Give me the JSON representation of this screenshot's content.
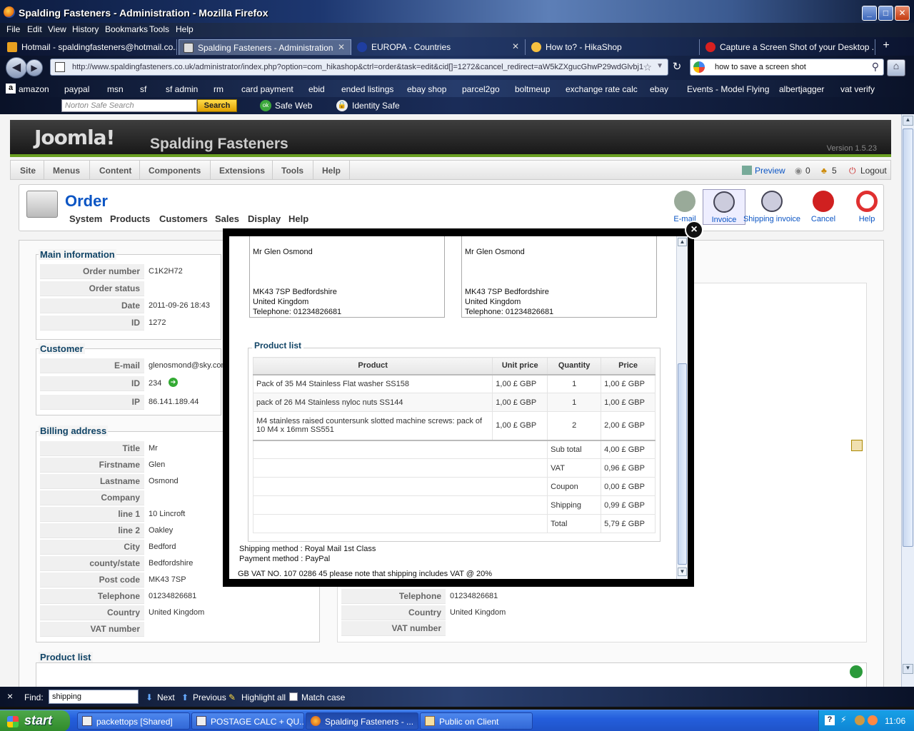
{
  "window": {
    "title": "Spalding Fasteners - Administration - Mozilla Firefox"
  },
  "menubar": [
    "File",
    "Edit",
    "View",
    "History",
    "Bookmarks",
    "Tools",
    "Help"
  ],
  "tabs": [
    {
      "label": "Hotmail - spaldingfasteners@hotmail.co...",
      "active": false
    },
    {
      "label": "Spalding Fasteners - Administration",
      "active": true
    },
    {
      "label": "EUROPA - Countries",
      "active": false
    },
    {
      "label": "How to? - HikaShop",
      "active": false
    },
    {
      "label": "Capture a Screen Shot of your Desktop ...",
      "active": false
    }
  ],
  "address": {
    "url": "http://www.spaldingfasteners.co.uk/administrator/index.php?option=com_hikashop&ctrl=order&task=edit&cid[]=1272&cancel_redirect=aW5kZXgucGhwP29wdGlvbj1"
  },
  "search": {
    "value": "how to save a screen shot"
  },
  "bookmarks": [
    "amazon",
    "paypal",
    "msn",
    "sf",
    "sf admin",
    "rm",
    "card payment",
    "ebid",
    "ended listings",
    "ebay shop",
    "parcel2go",
    "boltmeup",
    "exchange rate calc",
    "ebay",
    "Events - Model Flying",
    "albertjagger",
    "vat verify"
  ],
  "norton": {
    "placeholder": "Norton Safe Search",
    "search_label": "Search",
    "safeweb": "Safe Web",
    "identity": "Identity Safe"
  },
  "joomla": {
    "logo": "Joomla!",
    "site": "Spalding Fasteners",
    "version": "Version 1.5.23",
    "menu": [
      "Site",
      "Menus",
      "Content",
      "Components",
      "Extensions",
      "Tools",
      "Help"
    ],
    "right": {
      "preview": "Preview",
      "count1": "0",
      "count2": "5",
      "logout": "Logout"
    }
  },
  "order_header": {
    "title": "Order",
    "subnav": [
      "System",
      "Products",
      "Customers",
      "Sales",
      "Display",
      "Help"
    ],
    "toolbar": [
      "E-mail",
      "Invoice",
      "Shipping invoice",
      "Cancel",
      "Help"
    ]
  },
  "main_information": {
    "legend": "Main information",
    "rows": [
      {
        "k": "Order number",
        "v": "C1K2H72"
      },
      {
        "k": "Order status",
        "v": ""
      },
      {
        "k": "Date",
        "v": "2011-09-26 18:43"
      },
      {
        "k": "ID",
        "v": "1272"
      }
    ]
  },
  "customer": {
    "legend": "Customer",
    "rows": [
      {
        "k": "E-mail",
        "v": "glenosmond@sky.com"
      },
      {
        "k": "ID",
        "v": "234"
      },
      {
        "k": "IP",
        "v": "86.141.189.44"
      }
    ]
  },
  "billing": {
    "legend": "Billing address",
    "rows": [
      {
        "k": "Title",
        "v": "Mr"
      },
      {
        "k": "Firstname",
        "v": "Glen"
      },
      {
        "k": "Lastname",
        "v": "Osmond"
      },
      {
        "k": "Company",
        "v": ""
      },
      {
        "k": "line 1",
        "v": "10 Lincroft"
      },
      {
        "k": "line 2",
        "v": "Oakley"
      },
      {
        "k": "City",
        "v": "Bedford"
      },
      {
        "k": "county/state",
        "v": "Bedfordshire"
      },
      {
        "k": "Post code",
        "v": "MK43 7SP"
      },
      {
        "k": "Telephone",
        "v": "01234826681"
      },
      {
        "k": "Country",
        "v": "United Kingdom"
      },
      {
        "k": "VAT number",
        "v": ""
      }
    ]
  },
  "shipping_right": {
    "rows": [
      {
        "k": "Telephone",
        "v": "01234826681"
      },
      {
        "k": "Country",
        "v": "United Kingdom"
      },
      {
        "k": "VAT number",
        "v": ""
      }
    ]
  },
  "product_list_legend": "Product list",
  "invoice": {
    "billing": [
      "Mr Glen Osmond",
      "",
      "",
      "",
      "MK43 7SP Bedfordshire",
      "United Kingdom",
      "Telephone: 01234826681"
    ],
    "shipping": [
      "Mr Glen Osmond",
      "",
      "",
      "",
      "MK43 7SP Bedfordshire",
      "United Kingdom",
      "Telephone: 01234826681"
    ],
    "product_list_title": "Product list",
    "headers": [
      "Product",
      "Unit price",
      "Quantity",
      "Price"
    ],
    "items": [
      {
        "product": "Pack of 35 M4 Stainless Flat washer SS158",
        "unit": "1,00 £ GBP",
        "qty": "1",
        "price": "1,00 £ GBP"
      },
      {
        "product": "pack of 26 M4 Stainless nyloc nuts SS144",
        "unit": "1,00 £ GBP",
        "qty": "1",
        "price": "1,00 £ GBP"
      },
      {
        "product": "M4 stainless raised countersunk slotted machine screws: pack of 10 M4 x 16mm SS551",
        "unit": "1,00 £ GBP",
        "qty": "2",
        "price": "2,00 £ GBP"
      }
    ],
    "totals": [
      {
        "label": "Sub total",
        "value": "4,00 £ GBP"
      },
      {
        "label": "VAT",
        "value": "0,96 £ GBP"
      },
      {
        "label": "Coupon",
        "value": "0,00 £ GBP"
      },
      {
        "label": "Shipping",
        "value": "0,99 £ GBP"
      },
      {
        "label": "Total",
        "value": "5,79 £ GBP"
      }
    ],
    "shipping_method": "Shipping method : Royal Mail 1st Class",
    "payment_method": "Payment method : PayPal",
    "vat_note": "GB VAT NO. 107 0286 45 please note that shipping includes VAT @ 20%"
  },
  "findbar": {
    "label": "Find:",
    "value": "shipping",
    "next": "Next",
    "previous": "Previous",
    "highlight": "Highlight all",
    "match": "Match case"
  },
  "taskbar": {
    "start": "start",
    "items": [
      "packettops [Shared]",
      "POSTAGE CALC + QU...",
      "Spalding Fasteners - ...",
      "Public on Client"
    ],
    "clock": "11:06"
  }
}
